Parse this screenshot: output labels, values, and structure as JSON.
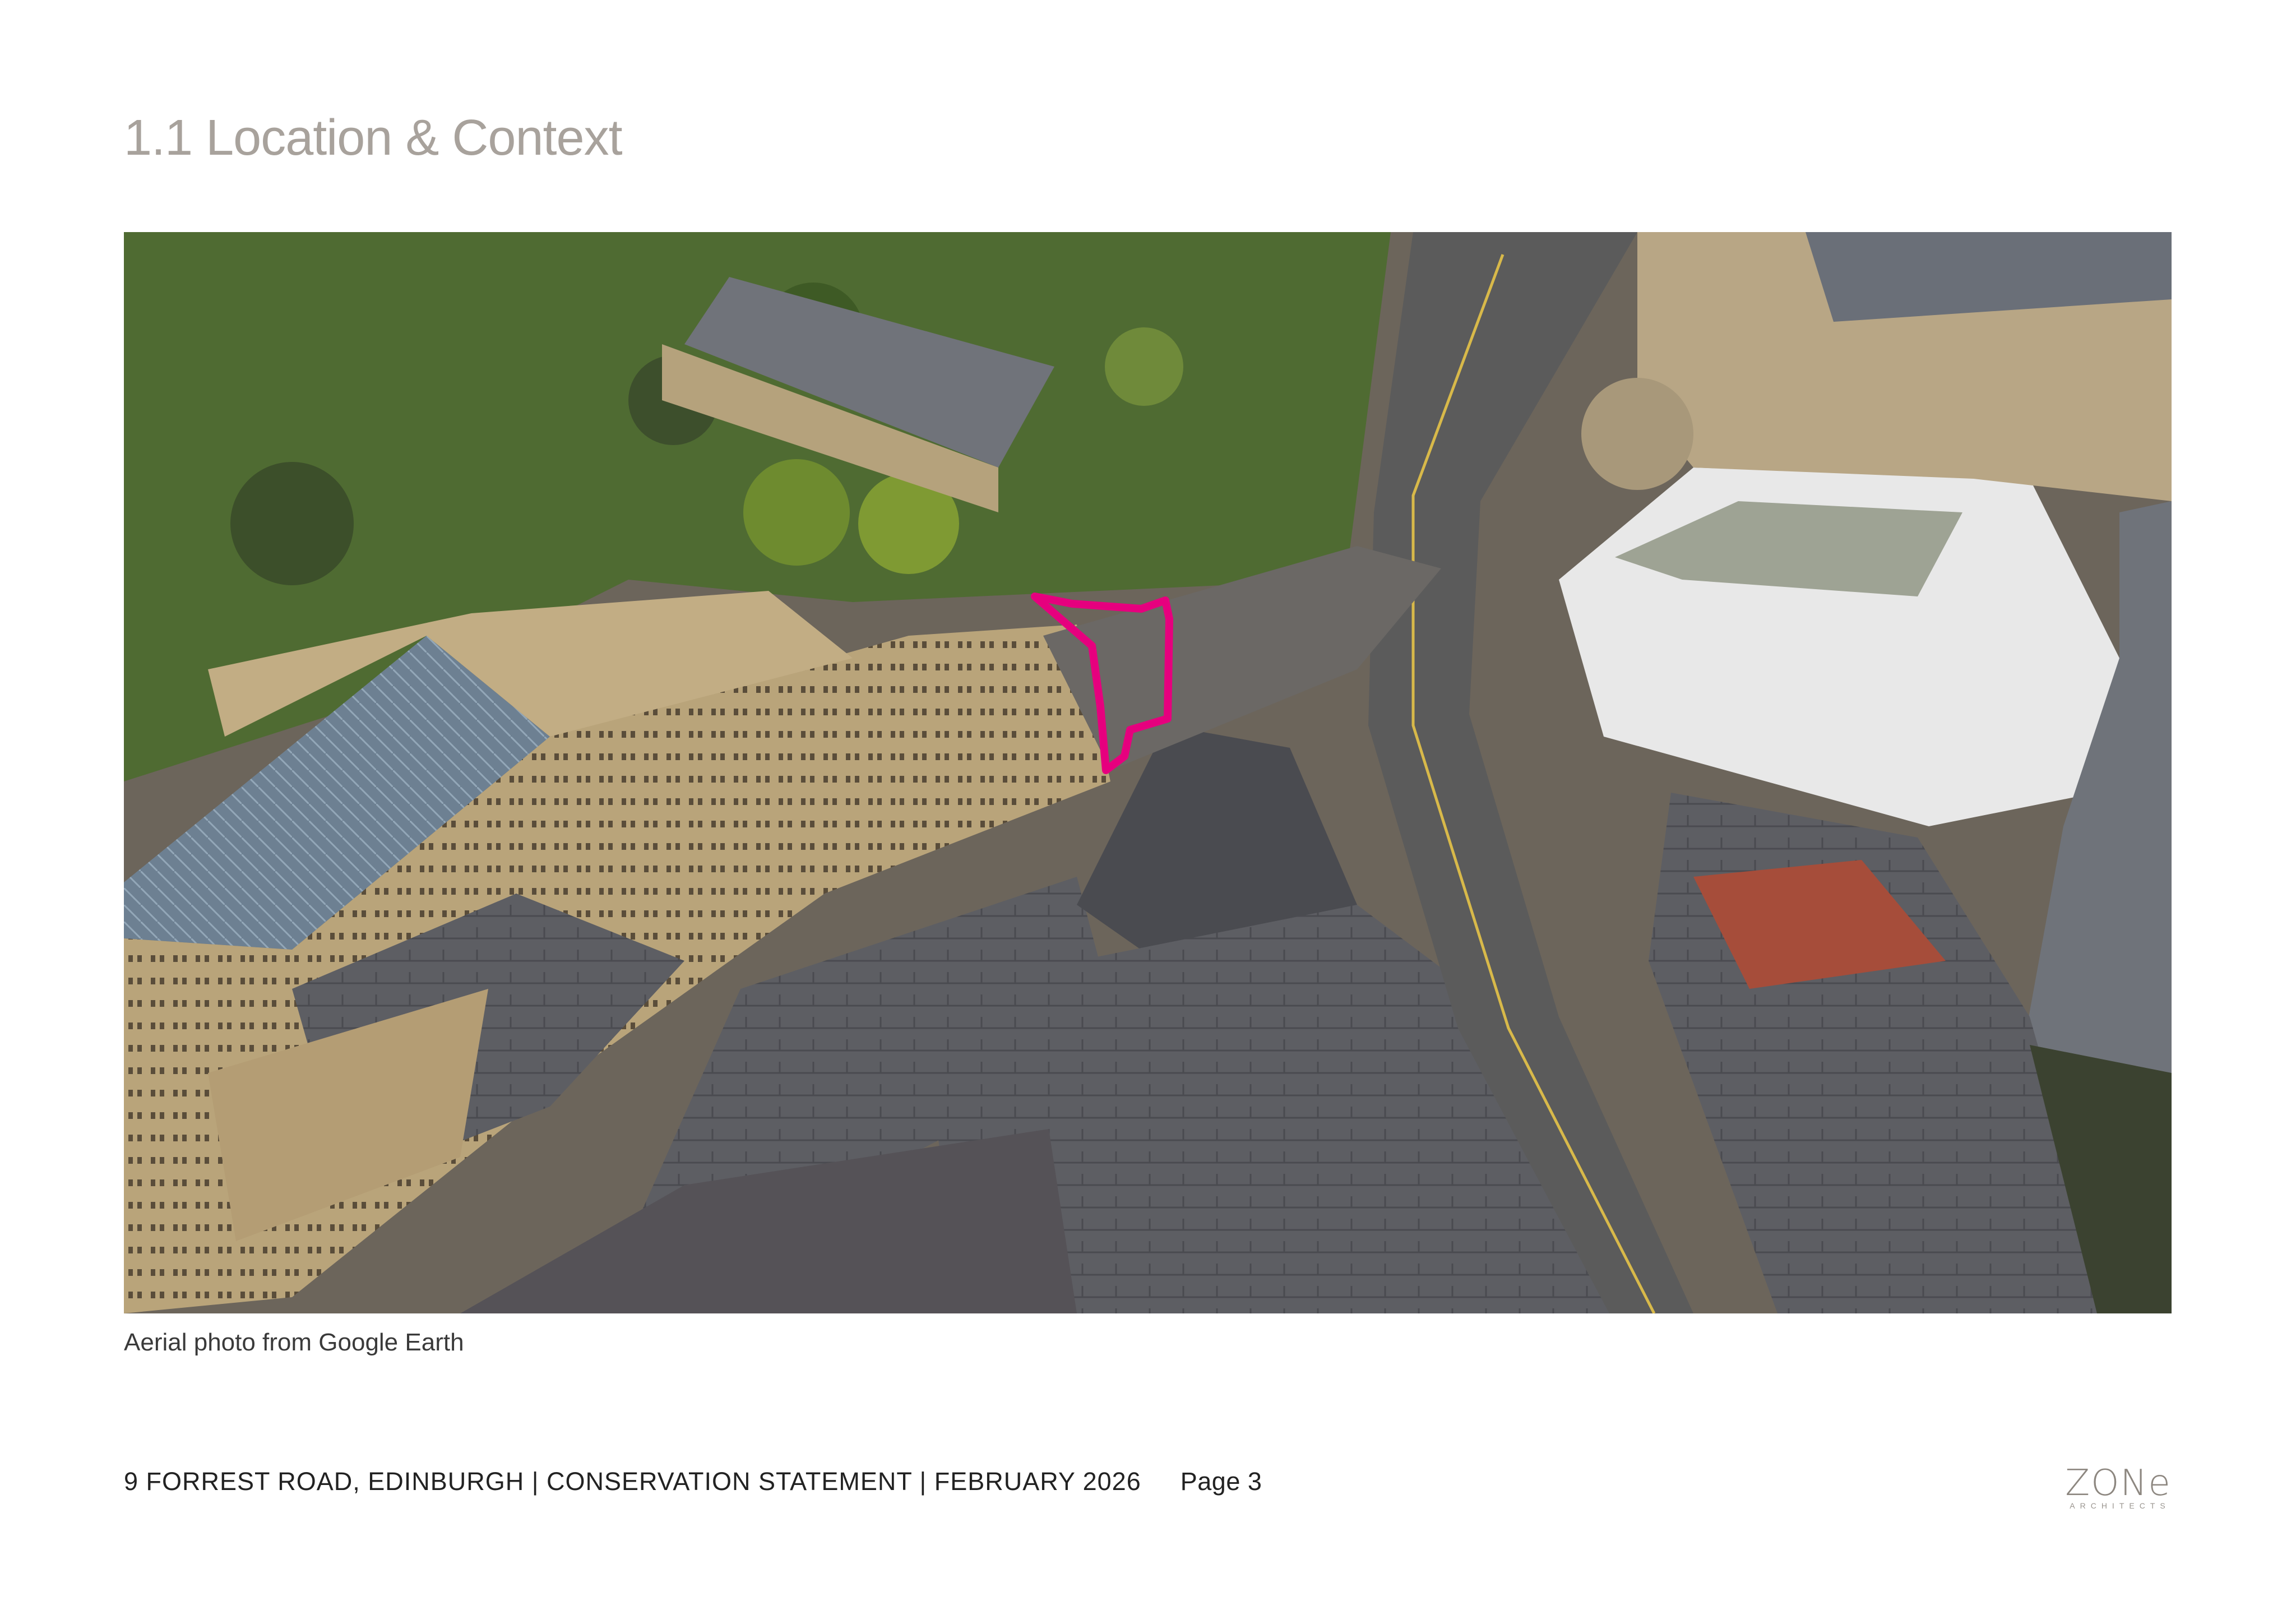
{
  "title": "1.1 Location & Context",
  "photo": {
    "alt": "Aerial photo of Forrest Road, Edinburgh with site outlined in magenta",
    "highlight_color": "#e6007e"
  },
  "caption": "Aerial photo from Google Earth",
  "footer": {
    "text": "9 FORREST ROAD, EDINBURGH | CONSERVATION STATEMENT | FEBRUARY 2026",
    "page": "Page 3"
  },
  "logo": {
    "wordmark": "ZONe",
    "subtitle": "ARCHITECTS"
  }
}
